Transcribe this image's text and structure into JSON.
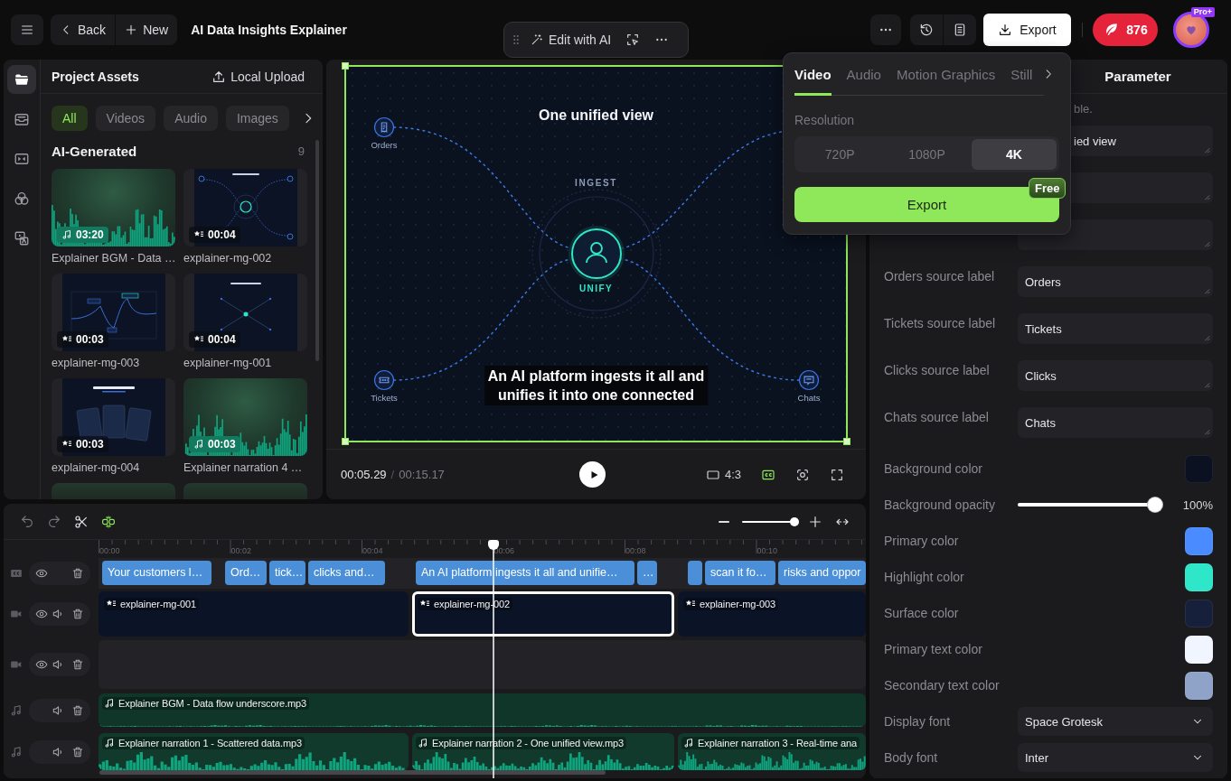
{
  "topbar": {
    "back": "Back",
    "new": "New",
    "title": "AI Data Insights Explainer",
    "export": "Export",
    "credits": "876",
    "plan": "Pro+"
  },
  "ai_toolbar": {
    "label": "Edit with AI"
  },
  "rail": [
    {
      "kind": "folder",
      "selected": true
    },
    {
      "kind": "tray",
      "selected": false
    },
    {
      "kind": "transition",
      "selected": false
    },
    {
      "kind": "blend",
      "selected": false
    },
    {
      "kind": "image-text",
      "selected": false
    }
  ],
  "assets": {
    "title": "Project Assets",
    "upload": "Local Upload",
    "filters": [
      {
        "label": "All",
        "selected": true
      },
      {
        "label": "Videos",
        "selected": false
      },
      {
        "label": "Audio",
        "selected": false
      },
      {
        "label": "Images",
        "selected": false
      }
    ],
    "section": "AI-Generated",
    "count": "9",
    "items": [
      {
        "kind": "audio",
        "name": "Explainer BGM - Data …",
        "duration": "03:20"
      },
      {
        "kind": "hub-graphic",
        "name": "explainer-mg-002",
        "duration": "00:04"
      },
      {
        "kind": "chart-graphic",
        "name": "explainer-mg-003",
        "duration": "00:03"
      },
      {
        "kind": "cross-graphic",
        "name": "explainer-mg-001",
        "duration": "00:04"
      },
      {
        "kind": "cards-graphic",
        "name": "explainer-mg-004",
        "duration": "00:03"
      },
      {
        "kind": "audio",
        "name": "Explainer narration 4 …",
        "duration": "00:03"
      },
      {
        "kind": "audio"
      },
      {
        "kind": "audio"
      }
    ]
  },
  "preview": {
    "heading": "One unified view",
    "sources": [
      {
        "kind": "receipt",
        "label": "Orders"
      },
      {
        "kind": "ticket",
        "label": "Tickets"
      },
      {
        "kind": "chat",
        "label": "Chats"
      }
    ],
    "ring_label": "INGEST",
    "hub_label": "UNIFY",
    "caption": "An AI platform ingests it all and\nunifies it into one connected",
    "current_time": "00:05.29",
    "separator": "/",
    "total_time": "00:15.17",
    "aspect": "4:3",
    "captions": true
  },
  "export_menu": {
    "tabs": [
      {
        "label": "Video",
        "selected": true
      },
      {
        "label": "Audio",
        "selected": false
      },
      {
        "label": "Motion Graphics",
        "selected": false
      },
      {
        "label": "Still",
        "selected": false
      }
    ],
    "resolution_label": "Resolution",
    "resolutions": [
      {
        "label": "720P",
        "selected": false
      },
      {
        "label": "1080P",
        "selected": false
      },
      {
        "label": "4K",
        "selected": true
      }
    ],
    "button": "Export",
    "badge": "Free"
  },
  "parameters": {
    "title": "Parameter",
    "note": "ble.",
    "covered_fields": [
      {
        "kind": "text",
        "value": "ied view"
      },
      {
        "kind": "blank"
      },
      {
        "kind": "blank"
      }
    ],
    "rows": [
      {
        "kind": "text",
        "label": "Orders source label",
        "value": "Orders"
      },
      {
        "kind": "text",
        "label": "Tickets source label",
        "value": "Tickets"
      },
      {
        "kind": "text",
        "label": "Clicks source label",
        "value": "Clicks"
      },
      {
        "kind": "text",
        "label": "Chats source label",
        "value": "Chats"
      },
      {
        "kind": "color",
        "label": "Background color",
        "color": "#0b1120"
      },
      {
        "kind": "slider",
        "label": "Background opacity",
        "level": 1,
        "reading": "100%"
      },
      {
        "kind": "color",
        "label": "Primary color",
        "color": "#4a8cff"
      },
      {
        "kind": "color",
        "label": "Highlight color",
        "color": "#2ee6c8"
      },
      {
        "kind": "color",
        "label": "Surface color",
        "color": "#16203a"
      },
      {
        "kind": "color",
        "label": "Primary text color",
        "color": "#f1f5ff"
      },
      {
        "kind": "color",
        "label": "Secondary text color",
        "color": "#8fa3c8"
      },
      {
        "kind": "select",
        "label": "Display font",
        "value": "Space Grotesk"
      },
      {
        "kind": "select",
        "label": "Body font",
        "value": "Inter"
      }
    ]
  },
  "timeline": {
    "zoom": {
      "level": 0.95
    },
    "ruler": [
      "00:00",
      "00:02",
      "00:04",
      "00:06",
      "00:08",
      "00:10"
    ],
    "tracks": [
      {
        "kind": "caption",
        "clips": [
          {
            "kind": "text",
            "label": "Your customers l…"
          },
          {
            "kind": "text",
            "label": "Ord…"
          },
          {
            "kind": "text",
            "label": "tick…"
          },
          {
            "kind": "text",
            "label": "clicks and…"
          },
          {
            "kind": "text",
            "label": "An AI platform ingests it all and unifie…"
          },
          {
            "kind": "text",
            "label": "…"
          },
          {
            "kind": "blank"
          },
          {
            "kind": "text",
            "label": "scan it fo…"
          },
          {
            "kind": "text",
            "label": "risks and oppor"
          }
        ]
      },
      {
        "kind": "video",
        "clips": [
          {
            "name": "explainer-mg-001",
            "selected": false
          },
          {
            "name": "explainer-mg-002",
            "selected": true
          },
          {
            "name": "explainer-mg-003",
            "selected": false
          }
        ]
      },
      {
        "kind": "video"
      },
      {
        "kind": "audio",
        "clips": [
          {
            "name": "Explainer BGM - Data flow underscore.mp3"
          }
        ]
      },
      {
        "kind": "audio",
        "clips": [
          {
            "name": "Explainer narration 1 - Scattered data.mp3"
          },
          {
            "name": "Explainer narration 2 - One unified view.mp3"
          },
          {
            "name": "Explainer narration 3 - Real-time ana"
          }
        ]
      }
    ]
  }
}
